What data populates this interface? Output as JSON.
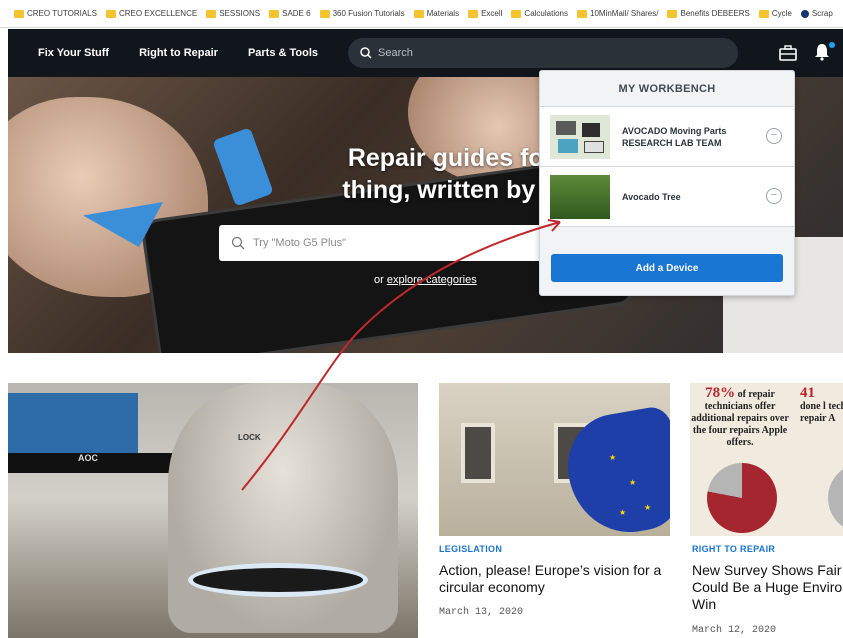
{
  "bookmarks": [
    "CREO TUTORIALS",
    "CREO EXCELLENCE",
    "SESSIONS",
    "SADE 6",
    "360 Fusion Tutorials",
    "Materials",
    "Excell",
    "Calculations",
    "10MinMail/ Shares/",
    "Benefits DEBEERS",
    "Cycle",
    "Scrap"
  ],
  "nav": {
    "links": [
      "Fix Your Stuff",
      "Right to Repair",
      "Parts & Tools"
    ],
    "search_placeholder": "Search"
  },
  "hero": {
    "title": "Repair guides for ev\nthing, written by ever",
    "search_placeholder": "Try \"Moto G5 Plus\"",
    "explore_prefix": "or",
    "explore_link": "explore categories"
  },
  "workbench": {
    "title": "MY WORKBENCH",
    "items": [
      {
        "name": "AVOCADO Moving Parts\nRESEARCH LAB TEAM"
      },
      {
        "name": "Avocado Tree"
      }
    ],
    "add_label": "Add a Device",
    "remove_glyph": "−"
  },
  "cards": [
    {
      "tag": "LEGISLATION",
      "headline": "Action, please! Europe’s vision for a circular economy",
      "date": "March 13, 2020"
    },
    {
      "tag": "RIGHT TO REPAIR",
      "headline": "New Survey Shows Fair Could Be a Huge Enviro Win",
      "date": "March 12, 2020"
    }
  ],
  "infographic": {
    "stat1_pct": "78%",
    "stat1_text": "of repair technicians offer additional repairs over the four repairs Apple offers.",
    "stat2_pct": "41",
    "stat2_text": "done l technic repair A",
    "pie_value_pct": 78
  },
  "photo": {
    "monitor_brand": "AOC",
    "lock_label": "LOCK"
  },
  "colors": {
    "nav_bg": "#11161c",
    "accent": "#1975d2",
    "annotation_arrow": "#c0272d"
  }
}
